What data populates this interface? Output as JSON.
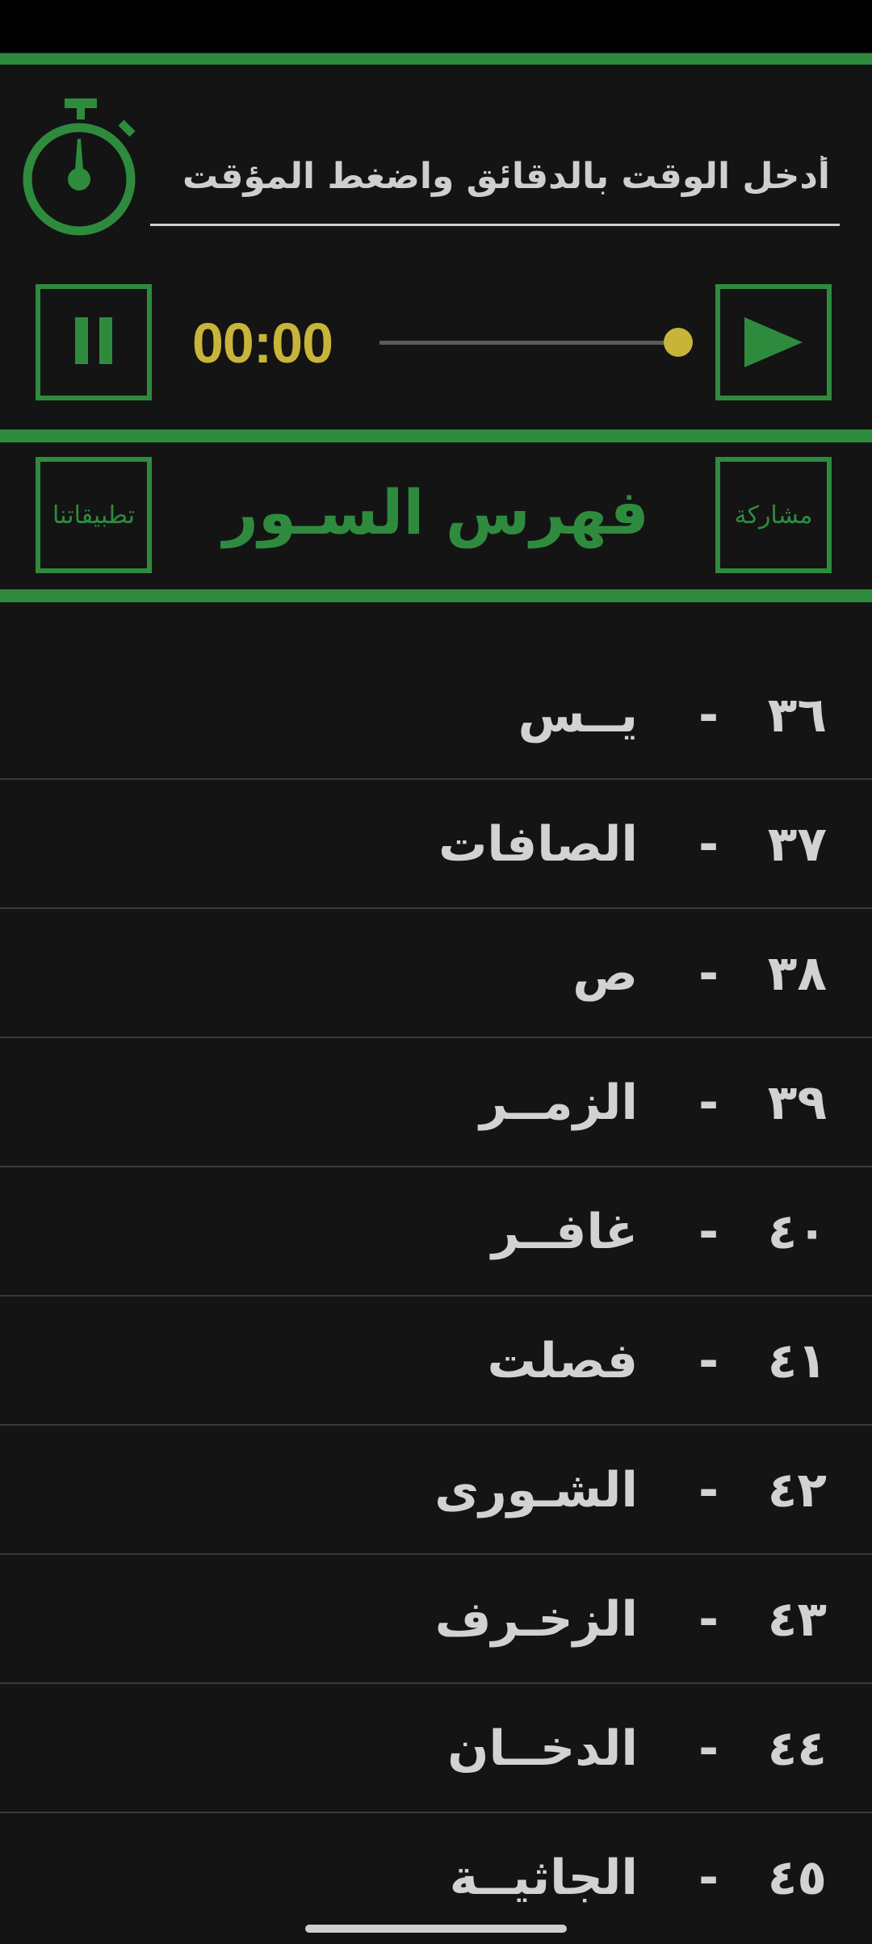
{
  "timer": {
    "input_placeholder": "أدخل الوقت بالدقائق واضغط المؤقت",
    "input_value": "",
    "display": "00:00",
    "progress": 1.0
  },
  "header": {
    "title": "فهرس السـور",
    "share_label": "مشاركة",
    "apps_label": "تطبيقاتنا"
  },
  "surahs": [
    {
      "number": "٣٦",
      "name": "يــس"
    },
    {
      "number": "٣٧",
      "name": "الصافات"
    },
    {
      "number": "٣٨",
      "name": "ص"
    },
    {
      "number": "٣٩",
      "name": "الزمــر"
    },
    {
      "number": "٤٠",
      "name": "غافــر"
    },
    {
      "number": "٤١",
      "name": "فصلت"
    },
    {
      "number": "٤٢",
      "name": "الشـورى"
    },
    {
      "number": "٤٣",
      "name": "الزخـرف"
    },
    {
      "number": "٤٤",
      "name": "الدخــان"
    },
    {
      "number": "٤٥",
      "name": "الجاثيــة"
    }
  ],
  "colors": {
    "accent": "#2e8b3e",
    "timer_text": "#c9b43a",
    "background": "#141414",
    "list_text": "#d2d2d2"
  },
  "icons": {
    "stopwatch": "stopwatch-icon",
    "play": "play-icon",
    "pause": "pause-icon"
  }
}
